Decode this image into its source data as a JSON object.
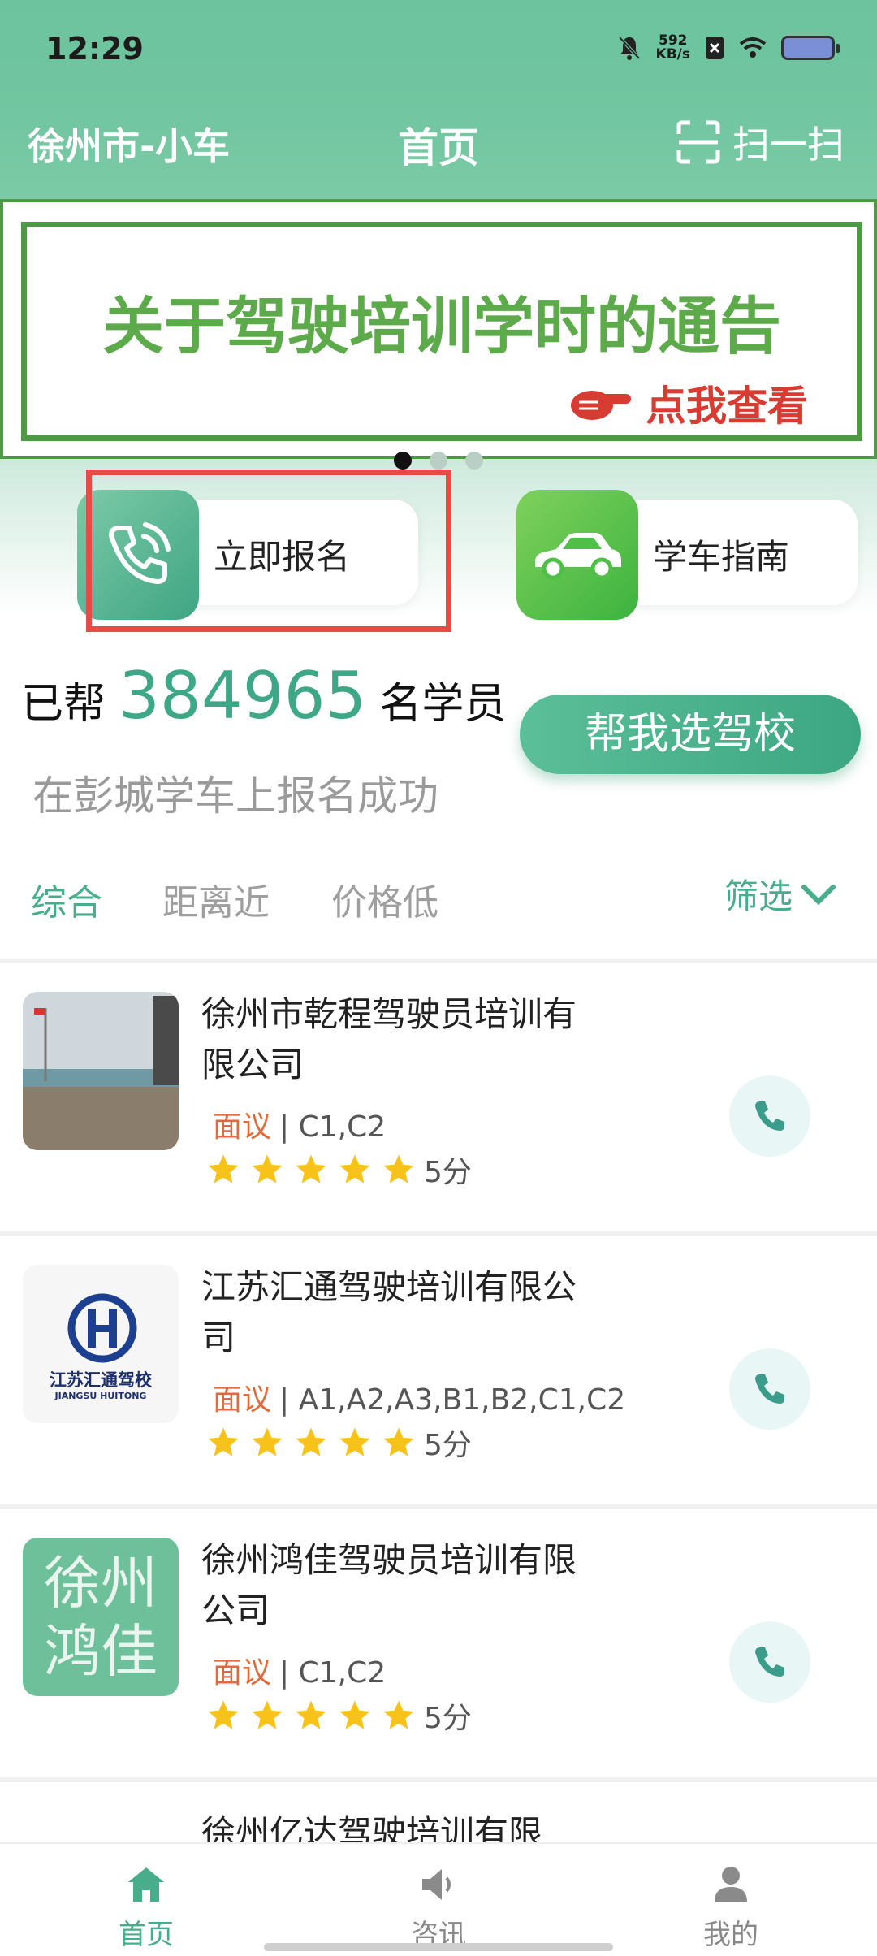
{
  "status_bar": {
    "time": "12:29",
    "net_speed_value": "592",
    "net_speed_unit": "KB/s"
  },
  "header": {
    "city": "徐州市-小车",
    "title": "首页",
    "scan_label": "扫一扫"
  },
  "banner": {
    "title": "关于驾驶培训学时的通告",
    "cta": "点我查看",
    "active_index": 0,
    "total": 3
  },
  "quick_actions": {
    "signup": "立即报名",
    "guide": "学车指南"
  },
  "stats": {
    "prefix": "已帮",
    "count": "384965",
    "suffix": "名学员",
    "subtitle": "在彭城学车上报名成功"
  },
  "pick_button": "帮我选驾校",
  "sort_tabs": {
    "composite": "综合",
    "distance": "距离近",
    "price": "价格低",
    "filter": "筛选"
  },
  "schools": [
    {
      "name": "徐州市乾程驾驶员培训有限公司",
      "price": "面议",
      "licenses": "C1,C2",
      "rating": 5,
      "score": "5分"
    },
    {
      "name": "江苏汇通驾驶培训有限公司",
      "price": "面议",
      "licenses": "A1,A2,A3,B1,B2,C1,C2",
      "rating": 5,
      "score": "5分",
      "logo_text": "江苏汇通驾校",
      "logo_sub": "JIANGSU HUITONG"
    },
    {
      "name": "徐州鸿佳驾驶员培训有限公司",
      "price": "面议",
      "licenses": "C1,C2",
      "rating": 5,
      "score": "5分",
      "logo_line1": "徐州",
      "logo_line2": "鸿佳"
    },
    {
      "name": "徐州亿达驾驶培训有限"
    }
  ],
  "bottom_nav": {
    "home": "首页",
    "news": "咨讯",
    "mine": "我的"
  },
  "colors": {
    "accent": "#48ad8b",
    "banner_green": "#5daa4b",
    "highlight": "#e84b45"
  }
}
